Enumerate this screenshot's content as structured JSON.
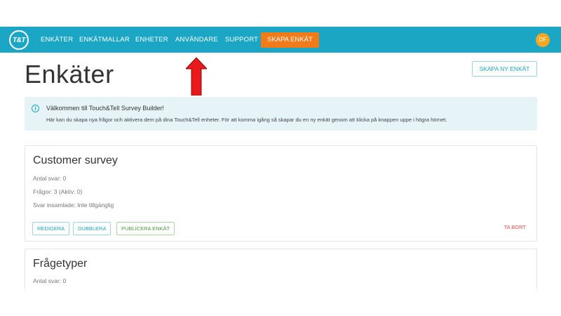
{
  "nav": {
    "logo": "T&T",
    "items": [
      {
        "label": "ENKÄTER"
      },
      {
        "label": "ENKÄTMALLAR"
      },
      {
        "label": "ENHETER"
      },
      {
        "label": "ANVÄNDARE"
      },
      {
        "label": "SUPPORT"
      }
    ],
    "cta": "SKAPA ENKÄT",
    "avatar_initials": "DF"
  },
  "page": {
    "title": "Enkäter",
    "new_survey_button": "SKAPA NY ENKÄT"
  },
  "info": {
    "icon": "info-icon",
    "title": "Välkommen till Touch&Tell Survey Builder!",
    "text": "Här kan du skapa nya frågor och aktivera dem på dina Touch&Tell enheter. För att komma igång så skapar du en ny enkät genom att klicka på knappen uppe i högra hörnet."
  },
  "surveys": [
    {
      "title": "Customer survey",
      "responses": "Antal svar: 0",
      "questions": "Frågor: 3 (Aktiv: 0)",
      "collected": "Svar insamlade: Inte tillgänglig",
      "buttons": {
        "edit": "REDIGERA",
        "duplicate": "DUBBLERA",
        "publish": "PUBLICERA ENKÄT",
        "delete": "TA BORT"
      }
    },
    {
      "title": "Frågetyper",
      "responses": "Antal svar: 0"
    }
  ],
  "colors": {
    "navbar": "#1aa6c4",
    "cta": "#f07b18",
    "avatar": "#f5a623",
    "delete": "#e04b4b",
    "annotation_arrow": "#e8191b"
  },
  "annotation": {
    "icon": "red-arrow-up-icon"
  }
}
